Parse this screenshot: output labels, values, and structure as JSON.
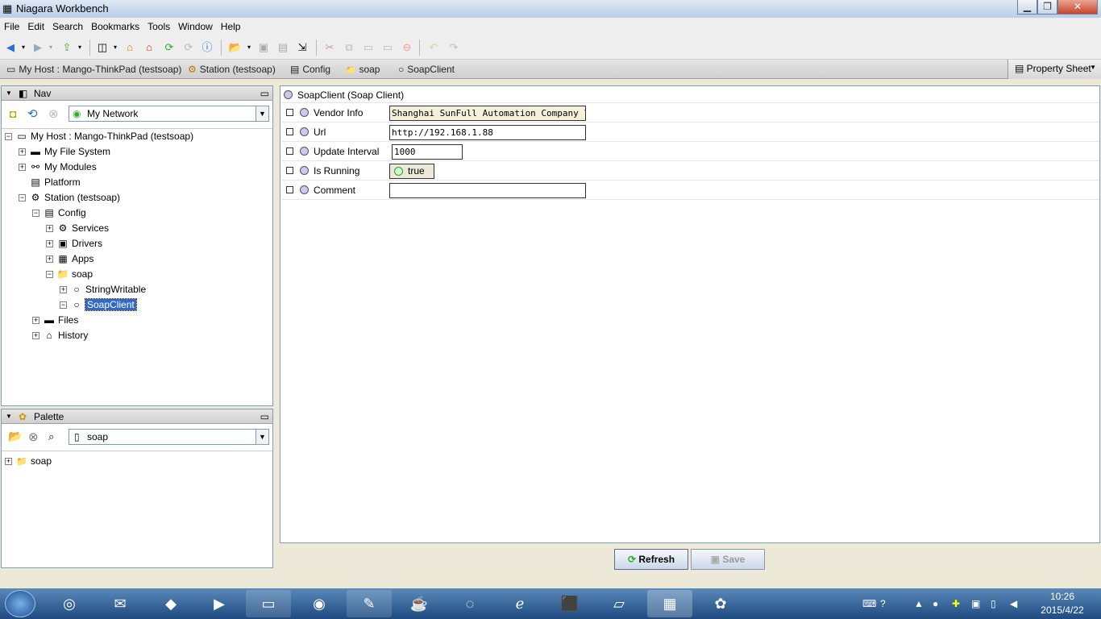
{
  "window": {
    "title": "Niagara Workbench",
    "min": "▁",
    "max": "❐",
    "close": "✕"
  },
  "menu": [
    "File",
    "Edit",
    "Search",
    "Bookmarks",
    "Tools",
    "Window",
    "Help"
  ],
  "locbar": {
    "crumbs": [
      {
        "icon": "host-icon",
        "glyph": "▭",
        "label": "My Host : Mango-ThinkPad (testsoap)"
      },
      {
        "icon": "station-icon",
        "glyph": "⚙",
        "label": "Station (testsoap)"
      },
      {
        "icon": "config-icon",
        "glyph": "▤",
        "label": "Config"
      },
      {
        "icon": "folder-icon",
        "glyph": "📁",
        "label": "soap"
      },
      {
        "icon": "component-icon",
        "glyph": "○",
        "label": "SoapClient"
      }
    ],
    "view_selector": "Property Sheet"
  },
  "nav": {
    "title": "Nav",
    "network_combo": "My Network",
    "tree": [
      {
        "label": "My Host : Mango-ThinkPad (testsoap)",
        "depth": 0,
        "exp": "−",
        "glyph": "▭"
      },
      {
        "label": "My File System",
        "depth": 1,
        "exp": "+",
        "glyph": "▬"
      },
      {
        "label": "My Modules",
        "depth": 1,
        "exp": "+",
        "glyph": "⚯"
      },
      {
        "label": "Platform",
        "depth": 1,
        "exp": "",
        "glyph": "▤"
      },
      {
        "label": "Station (testsoap)",
        "depth": 1,
        "exp": "−",
        "glyph": "⚙"
      },
      {
        "label": "Config",
        "depth": 2,
        "exp": "−",
        "glyph": "▤"
      },
      {
        "label": "Services",
        "depth": 3,
        "exp": "+",
        "glyph": "⚙"
      },
      {
        "label": "Drivers",
        "depth": 3,
        "exp": "+",
        "glyph": "▣"
      },
      {
        "label": "Apps",
        "depth": 3,
        "exp": "+",
        "glyph": "▦"
      },
      {
        "label": "soap",
        "depth": 3,
        "exp": "−",
        "glyph": "📁"
      },
      {
        "label": "StringWritable",
        "depth": 4,
        "exp": "+",
        "glyph": "○"
      },
      {
        "label": "SoapClient",
        "depth": 4,
        "exp": "−",
        "glyph": "○",
        "selected": true
      },
      {
        "label": "Files",
        "depth": 2,
        "exp": "+",
        "glyph": "▬"
      },
      {
        "label": "History",
        "depth": 2,
        "exp": "+",
        "glyph": "⌂"
      }
    ]
  },
  "palette": {
    "title": "Palette",
    "combo": "soap",
    "tree": [
      {
        "label": "soap",
        "exp": "+",
        "glyph": "📁"
      }
    ]
  },
  "property_sheet": {
    "header": "SoapClient  (Soap Client)",
    "rows": [
      {
        "label": "Vendor Info",
        "value": "Shanghai SunFull Automation Company ltd.",
        "readonly": true
      },
      {
        "label": "Url",
        "value": "http://192.168.1.88",
        "readonly": false
      },
      {
        "label": "Update Interval",
        "value": "1000",
        "readonly": false
      },
      {
        "label": "Is Running",
        "value": "true",
        "readonly": true
      },
      {
        "label": "Comment",
        "value": "",
        "readonly": false
      }
    ]
  },
  "buttons": {
    "refresh": "Refresh",
    "save": "Save"
  },
  "taskbar": {
    "time": "10:26",
    "date": "2015/4/22"
  },
  "colors": {
    "selection": "#316ac5",
    "taskbar": "#1e4a80"
  }
}
